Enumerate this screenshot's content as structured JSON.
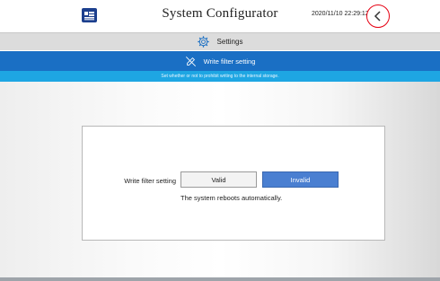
{
  "header": {
    "title": "System Configurator",
    "datetime": "2020/11/10 22:29:12",
    "logo_icon": "company-logo",
    "back_icon": "chevron-left-icon",
    "highlight_color": "#e60012"
  },
  "settings_bar": {
    "label": "Settings",
    "icon": "gear-icon"
  },
  "section": {
    "title": "Write filter setting",
    "icon": "pencil-off-icon",
    "description": "Set whether or not to prohibit writing to the internal storage.",
    "color": "#1a6fc4",
    "desc_color": "#1ea6e3"
  },
  "write_filter": {
    "label": "Write filter setting",
    "options": [
      "Valid",
      "Invalid"
    ],
    "selected": "Invalid",
    "note": "The system reboots automatically."
  }
}
